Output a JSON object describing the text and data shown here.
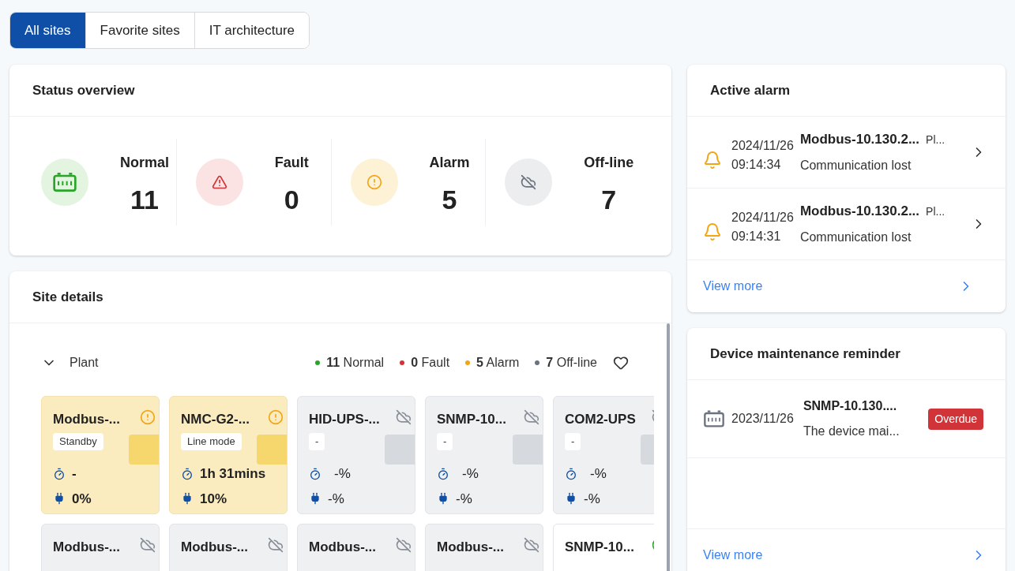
{
  "tabs": [
    {
      "label": "All sites",
      "selected": true
    },
    {
      "label": "Favorite sites",
      "selected": false
    },
    {
      "label": "IT architecture",
      "selected": false
    }
  ],
  "status_overview": {
    "title": "Status overview",
    "items": [
      {
        "kind": "normal",
        "label": "Normal",
        "count": "11"
      },
      {
        "kind": "fault",
        "label": "Fault",
        "count": "0"
      },
      {
        "kind": "alarm",
        "label": "Alarm",
        "count": "5"
      },
      {
        "kind": "offline",
        "label": "Off-line",
        "count": "7"
      }
    ]
  },
  "site_details": {
    "title": "Site details",
    "group": {
      "name": "Plant",
      "expanded": true,
      "favorite": false,
      "summary": [
        {
          "count": "11",
          "label": "Normal",
          "color": "#2aa52a"
        },
        {
          "count": "0",
          "label": "Fault",
          "color": "#d13438"
        },
        {
          "count": "5",
          "label": "Alarm",
          "color": "#f2a516"
        },
        {
          "count": "7",
          "label": "Off-line",
          "color": "#6b7280"
        }
      ],
      "devices": [
        {
          "name": "Modbus-...",
          "kind": "alarm",
          "mode": "Standby",
          "time": "-",
          "load": "0%"
        },
        {
          "name": "NMC-G2-...",
          "kind": "alarm",
          "mode": "Line mode",
          "time": "1h 31mins",
          "load": "10%"
        },
        {
          "name": "HID-UPS-...",
          "kind": "offline",
          "mode": "-",
          "time": "-%",
          "load": "-%"
        },
        {
          "name": "SNMP-10...",
          "kind": "offline",
          "mode": "-",
          "time": "-%",
          "load": "-%"
        },
        {
          "name": "COM2-UPS",
          "kind": "offline",
          "mode": "-",
          "time": "-%",
          "load": "-%"
        },
        {
          "name": "Modbus-...",
          "kind": "offline"
        },
        {
          "name": "Modbus-...",
          "kind": "offline"
        },
        {
          "name": "Modbus-...",
          "kind": "offline"
        },
        {
          "name": "Modbus-...",
          "kind": "offline"
        },
        {
          "name": "SNMP-10...",
          "kind": "normal"
        }
      ]
    }
  },
  "active_alarm": {
    "title": "Active alarm",
    "items": [
      {
        "date": "2024/11/26",
        "time": "09:14:34",
        "device": "Modbus-10.130.2...",
        "site": "Pl...",
        "message": "Communication lost"
      },
      {
        "date": "2024/11/26",
        "time": "09:14:31",
        "device": "Modbus-10.130.2...",
        "site": "Pl...",
        "message": "Communication lost"
      }
    ],
    "view_more": "View more"
  },
  "maintenance": {
    "title": "Device maintenance reminder",
    "items": [
      {
        "date": "2023/11/26",
        "device": "SNMP-10.130....",
        "message": "The device mai...",
        "status": "Overdue"
      }
    ],
    "view_more": "View more"
  }
}
